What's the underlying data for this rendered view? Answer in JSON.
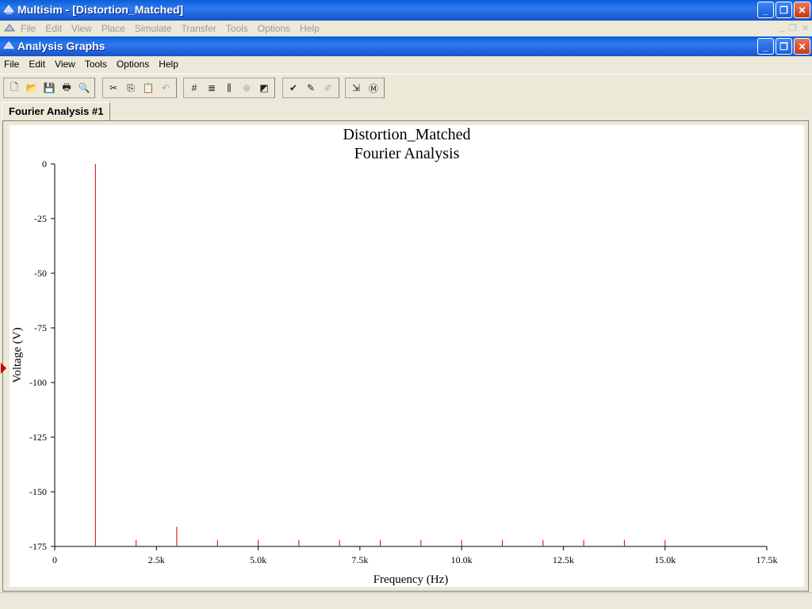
{
  "app": {
    "title": "Multisim - [Distortion_Matched]",
    "menu": [
      "File",
      "Edit",
      "View",
      "Place",
      "Simulate",
      "Transfer",
      "Tools",
      "Options",
      "Help"
    ]
  },
  "graphs_window": {
    "title": "Analysis Graphs",
    "menu": [
      "File",
      "Edit",
      "View",
      "Tools",
      "Options",
      "Help"
    ]
  },
  "toolbar": {
    "groups": [
      [
        "new-icon",
        "open-icon",
        "save-icon",
        "print-icon",
        "print-preview-icon"
      ],
      [
        "cut-icon",
        "copy-icon",
        "paste-icon",
        "undo-icon"
      ],
      [
        "grid-icon",
        "legend-icon",
        "cursors-icon",
        "zoom-icon",
        "reverse-colors-icon"
      ],
      [
        "overlay-traces-icon",
        "add-trace-icon",
        "remove-trace-icon"
      ],
      [
        "export-excel-icon",
        "export-mathcad-icon"
      ]
    ],
    "disabled": [
      "paste-icon",
      "undo-icon",
      "zoom-icon",
      "remove-trace-icon"
    ]
  },
  "tabs": [
    {
      "label": "Fourier Analysis #1",
      "active": true
    }
  ],
  "colors": {
    "trace": "#cc0000",
    "plot_bg": "#ffffff",
    "axes": "#000000",
    "window_bg": "#ece9d8"
  },
  "chart_data": {
    "type": "bar",
    "title": "Distortion_Matched",
    "subtitle": "Fourier Analysis",
    "xlabel": "Frequency (Hz)",
    "ylabel": "Voltage (V)",
    "xlim": [
      0,
      17500
    ],
    "ylim": [
      -175,
      0
    ],
    "xticks": [
      0,
      2500,
      5000,
      7500,
      10000,
      12500,
      15000,
      17500
    ],
    "xtick_labels": [
      "0",
      "2.5k",
      "5.0k",
      "7.5k",
      "10.0k",
      "12.5k",
      "15.0k",
      "17.5k"
    ],
    "yticks": [
      0,
      -25,
      -50,
      -75,
      -100,
      -125,
      -150,
      -175
    ],
    "ytick_labels": [
      "0",
      "-25",
      "-50",
      "-75",
      "-100",
      "-125",
      "-150",
      "-175"
    ],
    "grid": false,
    "series": [
      {
        "x": [
          1000,
          2000,
          3000,
          4000,
          5000,
          6000,
          7000,
          8000,
          9000,
          10000,
          11000,
          12000,
          13000,
          14000,
          15000
        ],
        "values": [
          0,
          -172,
          -166,
          -172,
          -172,
          -172,
          -172,
          -172,
          -172,
          -172,
          -172,
          -172,
          -172,
          -172,
          -172
        ]
      }
    ]
  }
}
